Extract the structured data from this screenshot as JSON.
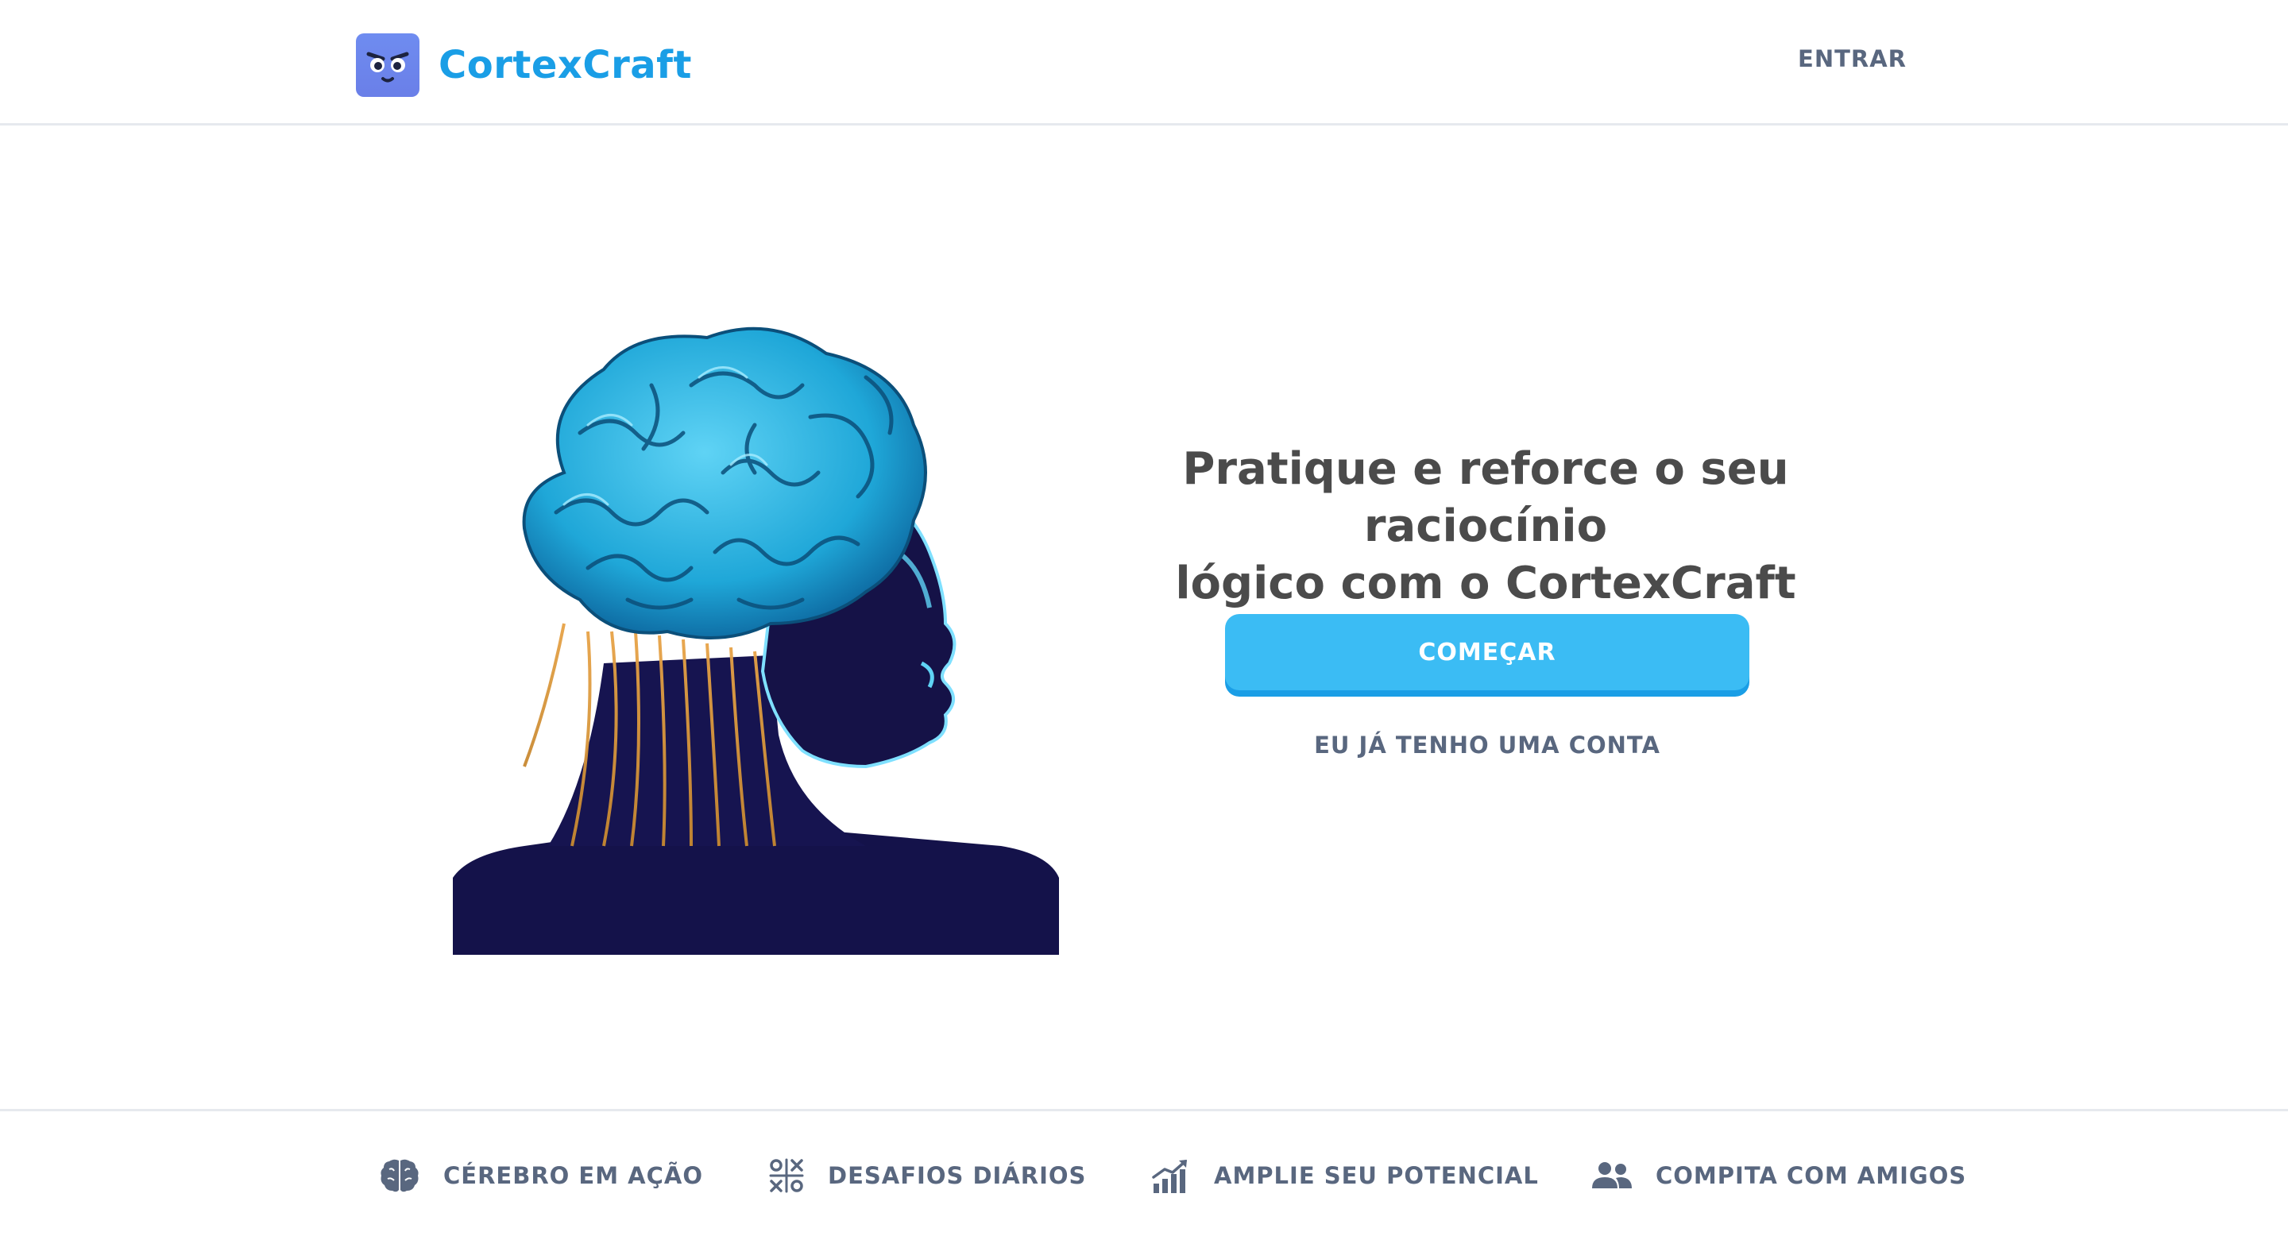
{
  "header": {
    "brand": "CortexCraft",
    "login_label": "ENTRAR"
  },
  "hero": {
    "headline_line1": "Pratique e reforce o seu raciocínio",
    "headline_line2": "lógico com o CortexCraft",
    "start_button": "COMEÇAR",
    "account_link": "EU JÁ TENHO UMA CONTA"
  },
  "features": [
    {
      "icon": "brain-icon",
      "label": "CÉREBRO EM AÇÃO"
    },
    {
      "icon": "tic-tac-toe-icon",
      "label": "DESAFIOS DIÁRIOS"
    },
    {
      "icon": "growth-chart-icon",
      "label": "AMPLIE SEU POTENCIAL"
    },
    {
      "icon": "users-icon",
      "label": "COMPITA COM AMIGOS"
    }
  ],
  "colors": {
    "brand_blue": "#1a9ee6",
    "button_blue": "#3bbcf4",
    "muted_text": "#59677f",
    "headline": "#4b4b4b",
    "logo_purple": "#6f8cf0"
  }
}
